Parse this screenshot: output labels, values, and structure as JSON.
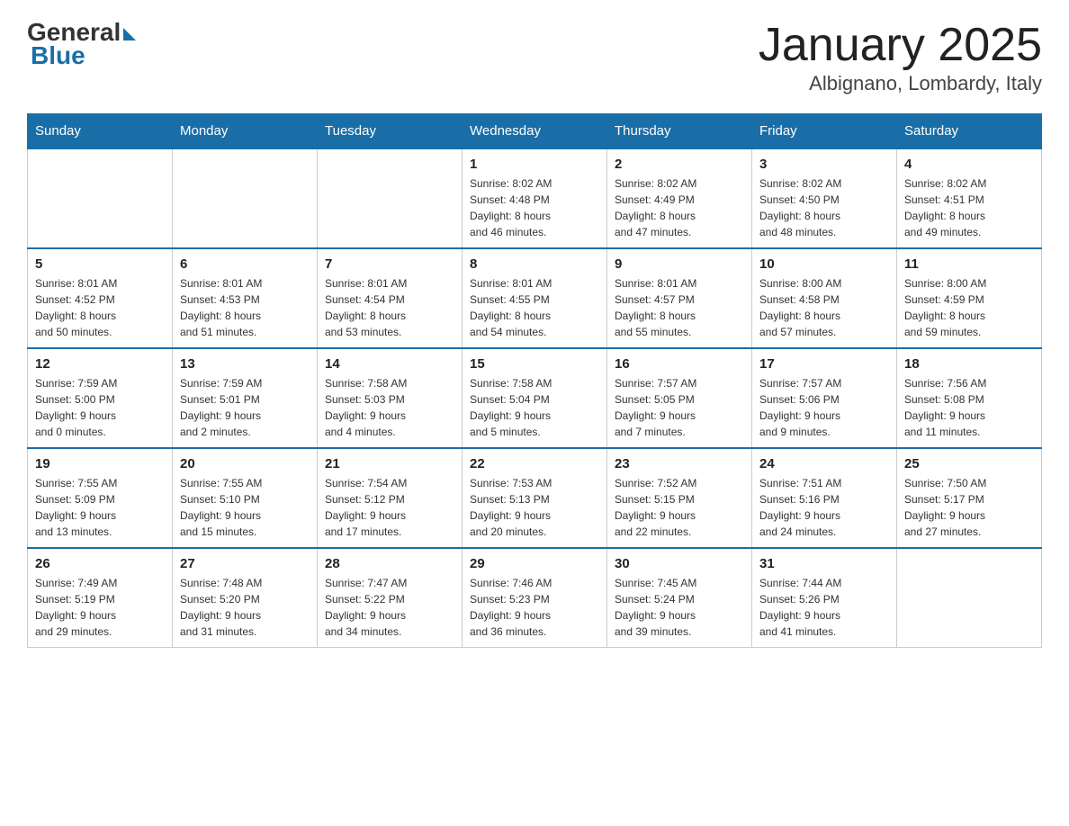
{
  "header": {
    "logo_general": "General",
    "logo_blue": "Blue",
    "title": "January 2025",
    "subtitle": "Albignano, Lombardy, Italy"
  },
  "days_of_week": [
    "Sunday",
    "Monday",
    "Tuesday",
    "Wednesday",
    "Thursday",
    "Friday",
    "Saturday"
  ],
  "weeks": [
    [
      {
        "day": "",
        "info": ""
      },
      {
        "day": "",
        "info": ""
      },
      {
        "day": "",
        "info": ""
      },
      {
        "day": "1",
        "info": "Sunrise: 8:02 AM\nSunset: 4:48 PM\nDaylight: 8 hours\nand 46 minutes."
      },
      {
        "day": "2",
        "info": "Sunrise: 8:02 AM\nSunset: 4:49 PM\nDaylight: 8 hours\nand 47 minutes."
      },
      {
        "day": "3",
        "info": "Sunrise: 8:02 AM\nSunset: 4:50 PM\nDaylight: 8 hours\nand 48 minutes."
      },
      {
        "day": "4",
        "info": "Sunrise: 8:02 AM\nSunset: 4:51 PM\nDaylight: 8 hours\nand 49 minutes."
      }
    ],
    [
      {
        "day": "5",
        "info": "Sunrise: 8:01 AM\nSunset: 4:52 PM\nDaylight: 8 hours\nand 50 minutes."
      },
      {
        "day": "6",
        "info": "Sunrise: 8:01 AM\nSunset: 4:53 PM\nDaylight: 8 hours\nand 51 minutes."
      },
      {
        "day": "7",
        "info": "Sunrise: 8:01 AM\nSunset: 4:54 PM\nDaylight: 8 hours\nand 53 minutes."
      },
      {
        "day": "8",
        "info": "Sunrise: 8:01 AM\nSunset: 4:55 PM\nDaylight: 8 hours\nand 54 minutes."
      },
      {
        "day": "9",
        "info": "Sunrise: 8:01 AM\nSunset: 4:57 PM\nDaylight: 8 hours\nand 55 minutes."
      },
      {
        "day": "10",
        "info": "Sunrise: 8:00 AM\nSunset: 4:58 PM\nDaylight: 8 hours\nand 57 minutes."
      },
      {
        "day": "11",
        "info": "Sunrise: 8:00 AM\nSunset: 4:59 PM\nDaylight: 8 hours\nand 59 minutes."
      }
    ],
    [
      {
        "day": "12",
        "info": "Sunrise: 7:59 AM\nSunset: 5:00 PM\nDaylight: 9 hours\nand 0 minutes."
      },
      {
        "day": "13",
        "info": "Sunrise: 7:59 AM\nSunset: 5:01 PM\nDaylight: 9 hours\nand 2 minutes."
      },
      {
        "day": "14",
        "info": "Sunrise: 7:58 AM\nSunset: 5:03 PM\nDaylight: 9 hours\nand 4 minutes."
      },
      {
        "day": "15",
        "info": "Sunrise: 7:58 AM\nSunset: 5:04 PM\nDaylight: 9 hours\nand 5 minutes."
      },
      {
        "day": "16",
        "info": "Sunrise: 7:57 AM\nSunset: 5:05 PM\nDaylight: 9 hours\nand 7 minutes."
      },
      {
        "day": "17",
        "info": "Sunrise: 7:57 AM\nSunset: 5:06 PM\nDaylight: 9 hours\nand 9 minutes."
      },
      {
        "day": "18",
        "info": "Sunrise: 7:56 AM\nSunset: 5:08 PM\nDaylight: 9 hours\nand 11 minutes."
      }
    ],
    [
      {
        "day": "19",
        "info": "Sunrise: 7:55 AM\nSunset: 5:09 PM\nDaylight: 9 hours\nand 13 minutes."
      },
      {
        "day": "20",
        "info": "Sunrise: 7:55 AM\nSunset: 5:10 PM\nDaylight: 9 hours\nand 15 minutes."
      },
      {
        "day": "21",
        "info": "Sunrise: 7:54 AM\nSunset: 5:12 PM\nDaylight: 9 hours\nand 17 minutes."
      },
      {
        "day": "22",
        "info": "Sunrise: 7:53 AM\nSunset: 5:13 PM\nDaylight: 9 hours\nand 20 minutes."
      },
      {
        "day": "23",
        "info": "Sunrise: 7:52 AM\nSunset: 5:15 PM\nDaylight: 9 hours\nand 22 minutes."
      },
      {
        "day": "24",
        "info": "Sunrise: 7:51 AM\nSunset: 5:16 PM\nDaylight: 9 hours\nand 24 minutes."
      },
      {
        "day": "25",
        "info": "Sunrise: 7:50 AM\nSunset: 5:17 PM\nDaylight: 9 hours\nand 27 minutes."
      }
    ],
    [
      {
        "day": "26",
        "info": "Sunrise: 7:49 AM\nSunset: 5:19 PM\nDaylight: 9 hours\nand 29 minutes."
      },
      {
        "day": "27",
        "info": "Sunrise: 7:48 AM\nSunset: 5:20 PM\nDaylight: 9 hours\nand 31 minutes."
      },
      {
        "day": "28",
        "info": "Sunrise: 7:47 AM\nSunset: 5:22 PM\nDaylight: 9 hours\nand 34 minutes."
      },
      {
        "day": "29",
        "info": "Sunrise: 7:46 AM\nSunset: 5:23 PM\nDaylight: 9 hours\nand 36 minutes."
      },
      {
        "day": "30",
        "info": "Sunrise: 7:45 AM\nSunset: 5:24 PM\nDaylight: 9 hours\nand 39 minutes."
      },
      {
        "day": "31",
        "info": "Sunrise: 7:44 AM\nSunset: 5:26 PM\nDaylight: 9 hours\nand 41 minutes."
      },
      {
        "day": "",
        "info": ""
      }
    ]
  ]
}
